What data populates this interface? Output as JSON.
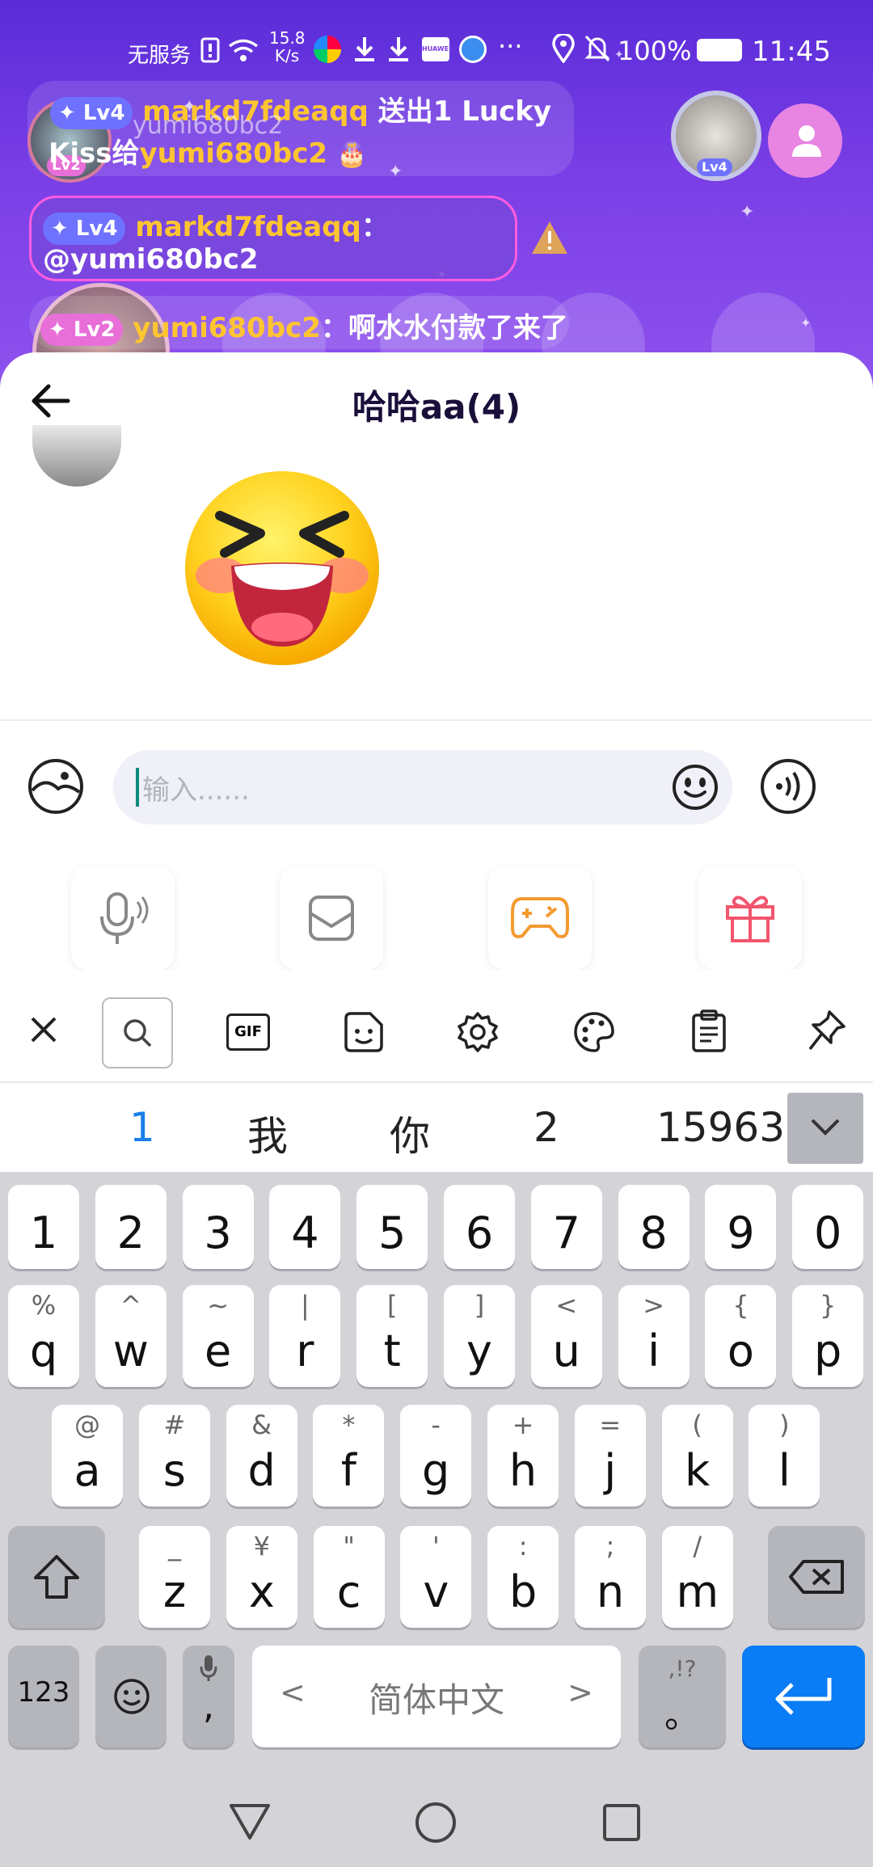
{
  "status_bar": {
    "carrier": "无服务",
    "speed_value": "15.8",
    "speed_unit": "K/s",
    "battery": "100%",
    "time": "11:45",
    "more": "···",
    "huawei": "HUAWEI"
  },
  "live": {
    "gift_msg": {
      "level": "Lv4",
      "sender": "markd7fdeaqq",
      "action": "送出1 Lucky",
      "line2_prefix": "Kiss给",
      "receiver": "yumi680bc2",
      "overlay_name": "yumi680bc2",
      "avatar_level": "Lv2"
    },
    "mention_msg": {
      "level": "Lv4",
      "sender": "markd7fdeaqq",
      "sep": "：",
      "text": "@yumi680bc2"
    },
    "chat_msg": {
      "level": "Lv2",
      "sender": "yumi680bc2",
      "sep": "：",
      "text": "啊水水付款了来了"
    },
    "host": {
      "level": "Lv4"
    }
  },
  "sheet": {
    "back_label": "←",
    "title": "哈哈aa(4)"
  },
  "composer": {
    "placeholder": "输入......"
  },
  "keyboard": {
    "candidates": [
      "1",
      "我",
      "你",
      "2",
      "15963"
    ],
    "num_row": [
      "1",
      "2",
      "3",
      "4",
      "5",
      "6",
      "7",
      "8",
      "9",
      "0"
    ],
    "row1": [
      {
        "k": "q",
        "s": "%"
      },
      {
        "k": "w",
        "s": "^"
      },
      {
        "k": "e",
        "s": "~"
      },
      {
        "k": "r",
        "s": "|"
      },
      {
        "k": "t",
        "s": "["
      },
      {
        "k": "y",
        "s": "]"
      },
      {
        "k": "u",
        "s": "<"
      },
      {
        "k": "i",
        "s": ">"
      },
      {
        "k": "o",
        "s": "{"
      },
      {
        "k": "p",
        "s": "}"
      }
    ],
    "row2": [
      {
        "k": "a",
        "s": "@"
      },
      {
        "k": "s",
        "s": "#"
      },
      {
        "k": "d",
        "s": "&"
      },
      {
        "k": "f",
        "s": "*"
      },
      {
        "k": "g",
        "s": "-"
      },
      {
        "k": "h",
        "s": "+"
      },
      {
        "k": "j",
        "s": "="
      },
      {
        "k": "k",
        "s": "("
      },
      {
        "k": "l",
        "s": ")"
      }
    ],
    "row3": [
      {
        "k": "z",
        "s": "_"
      },
      {
        "k": "x",
        "s": "¥"
      },
      {
        "k": "c",
        "s": "\""
      },
      {
        "k": "v",
        "s": "'"
      },
      {
        "k": "b",
        "s": ":"
      },
      {
        "k": "n",
        "s": ";"
      },
      {
        "k": "m",
        "s": "/"
      }
    ],
    "key_123": "123",
    "comma": ",",
    "space_label": "简体中文",
    "space_left": "<",
    "space_right": ">",
    "punct_top": ",!?",
    "punct_main": "。",
    "gif": "GIF"
  },
  "colors": {
    "accent": "#7a3ee6",
    "enter": "#0a7cf5",
    "badge_lv4": "#6f72ff",
    "badge_lv2": "#e86fd7",
    "nick": "#ffc531"
  }
}
